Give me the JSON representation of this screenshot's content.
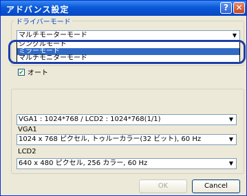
{
  "window": {
    "title": "アドバンス設定",
    "help_label": "?",
    "close_label": "✕"
  },
  "driver_mode": {
    "legend": "ドライバーモード",
    "selected": "マルチモーターモード",
    "options": [
      "シングルモード",
      "ミラーモード",
      "マルチモニターモード"
    ]
  },
  "auto": {
    "label": "オート",
    "checked": true
  },
  "display": {
    "layout_value": "VGA1 : 1024*768 / LCD2 : 1024*768(1/1)",
    "vga1_label": "VGA1",
    "vga1_value": "1024 x 768 ピクセル, トゥルーカラー(32 ビット), 60 Hz",
    "lcd2_label": "LCD2",
    "lcd2_value": "640 x 480 ピクセル, 256 カラー, 60 Hz"
  },
  "buttons": {
    "ok": "OK",
    "cancel": "Cancel"
  }
}
